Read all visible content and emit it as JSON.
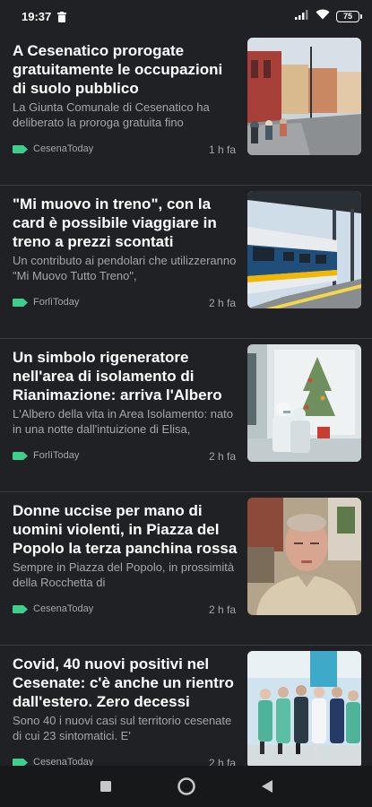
{
  "status_bar": {
    "time": "19:37",
    "battery": "75"
  },
  "articles": [
    {
      "title": "A Cesenatico prorogate gratuitamente le occupazioni di suolo pubblico",
      "snippet": "La Giunta Comunale di Cesenatico ha deliberato la proroga gratuita fino",
      "source": "CesenaToday",
      "time": "1 h fa"
    },
    {
      "title": "\"Mi muovo in treno\", con la card è possibile viaggiare in treno a prezzi scontati",
      "snippet": "Un contributo ai pendolari che utilizzeranno \"Mi Muovo Tutto Treno\",",
      "source": "ForlìToday",
      "time": "2 h fa"
    },
    {
      "title": "Un simbolo rigeneratore nell'area di isolamento di Rianimazione: arriva l'Albero",
      "snippet": "L'Albero della vita in Area Isolamento: nato in una notte dall'intuizione di Elisa,",
      "source": "ForlìToday",
      "time": "2 h fa"
    },
    {
      "title": "Donne uccise per mano di uomini violenti, in Piazza del Popolo la terza panchina rossa",
      "snippet": "Sempre in Piazza del Popolo, in prossimità della Rocchetta di",
      "source": "CesenaToday",
      "time": "2 h fa"
    },
    {
      "title": "Covid, 40 nuovi positivi nel Cesenate: c'è anche un rientro dall'estero. Zero decessi",
      "snippet": "Sono 40 i nuovi casi sul territorio cesenate di cui 23 sintomatici. E'",
      "source": "CesenaToday",
      "time": "2 h fa"
    }
  ],
  "colors": {
    "background": "#202124",
    "accent_tag": "#3ecf8e",
    "title": "#ffffff",
    "secondary": "#a4a6a9"
  }
}
